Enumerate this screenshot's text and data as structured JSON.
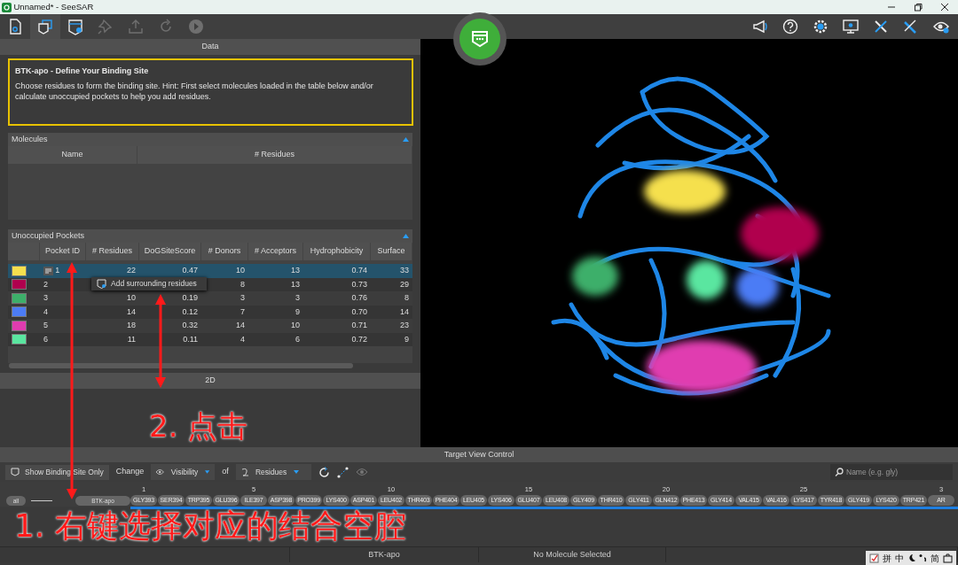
{
  "window": {
    "title": "Unnamed* - SeeSAR"
  },
  "toolbar": [
    {
      "selected": false,
      "disabled": false
    },
    {
      "selected": true,
      "disabled": false
    },
    {
      "selected": false,
      "disabled": false
    },
    {
      "selected": false,
      "disabled": true
    },
    {
      "selected": false,
      "disabled": true
    },
    {
      "selected": false,
      "disabled": true
    },
    {
      "selected": false,
      "disabled": true
    }
  ],
  "data_panel": {
    "title": "Data",
    "info": {
      "heading": "BTK-apo - Define Your Binding Site",
      "text": "Choose residues to form the binding site. Hint: First select molecules loaded in the table below and/or calculate unoccupied pockets to help you add residues."
    }
  },
  "molecules": {
    "title": "Molecules",
    "expanded": true,
    "columns": [
      "Name",
      "# Residues"
    ]
  },
  "pockets": {
    "title": "Unoccupied Pockets",
    "expanded": true,
    "columns": [
      "Pocket ID",
      "# Residues",
      "DoGSiteScore",
      "# Donors",
      "# Acceptors",
      "Hydrophobicity",
      "Surface"
    ],
    "rows": [
      {
        "color": "#f5e04e",
        "selected": true,
        "cells": [
          "1",
          "22",
          "0.47",
          "10",
          "13",
          "0.74",
          "33"
        ]
      },
      {
        "color": "#b0004e",
        "selected": false,
        "cells": [
          "2",
          "",
          "",
          "8",
          "13",
          "0.73",
          "29"
        ]
      },
      {
        "color": "#3daf6a",
        "selected": false,
        "cells": [
          "3",
          "10",
          "0.19",
          "3",
          "3",
          "0.76",
          "8"
        ]
      },
      {
        "color": "#4c7cf5",
        "selected": false,
        "cells": [
          "4",
          "14",
          "0.12",
          "7",
          "9",
          "0.70",
          "14"
        ]
      },
      {
        "color": "#e03cb0",
        "selected": false,
        "cells": [
          "5",
          "18",
          "0.32",
          "14",
          "10",
          "0.71",
          "23"
        ]
      },
      {
        "color": "#5ae6a0",
        "selected": false,
        "cells": [
          "6",
          "11",
          "0.11",
          "4",
          "6",
          "0.72",
          "9"
        ]
      }
    ],
    "context_menu": {
      "label": "Add surrounding residues"
    }
  },
  "panel_2d": {
    "title": "2D"
  },
  "target_view": {
    "title": "Target View Control",
    "show_binding_site": "Show Binding Site Only",
    "change_label": "Change",
    "visibility": "Visibility",
    "of_label": "of",
    "residues": "Residues",
    "search": {
      "placeholder": "Name (e.g. gly)"
    },
    "all_chip": "all",
    "chain_chip": "BTK-apo",
    "chips": [
      {
        "name": "GLY393",
        "tick": "1"
      },
      {
        "name": "SER394"
      },
      {
        "name": "TRP395"
      },
      {
        "name": "GLU396"
      },
      {
        "name": "ILE397",
        "tick": "5"
      },
      {
        "name": "ASP398"
      },
      {
        "name": "PRO399"
      },
      {
        "name": "LYS400"
      },
      {
        "name": "ASP401"
      },
      {
        "name": "LEU402",
        "tick": "10"
      },
      {
        "name": "THR403"
      },
      {
        "name": "PHE404"
      },
      {
        "name": "LEU405"
      },
      {
        "name": "LYS406"
      },
      {
        "name": "GLU407",
        "tick": "15"
      },
      {
        "name": "LEU408"
      },
      {
        "name": "GLY409"
      },
      {
        "name": "THR410"
      },
      {
        "name": "GLY411"
      },
      {
        "name": "GLN412",
        "tick": "20"
      },
      {
        "name": "PHE413"
      },
      {
        "name": "GLY414"
      },
      {
        "name": "VAL415"
      },
      {
        "name": "VAL416"
      },
      {
        "name": "LYS417",
        "tick": "25"
      },
      {
        "name": "TYR418"
      },
      {
        "name": "GLY419"
      },
      {
        "name": "LYS420"
      },
      {
        "name": "TRP421"
      },
      {
        "name": "AR",
        "tick": "3"
      }
    ]
  },
  "status_bar": {
    "structure": "BTK-apo",
    "molecule": "No Molecule Selected"
  },
  "ime_bar": [
    "拼",
    "中",
    "简"
  ],
  "annotations": [
    {
      "text": "2. 点击"
    },
    {
      "text": "1. 右键选择对应的结合空腔"
    }
  ]
}
